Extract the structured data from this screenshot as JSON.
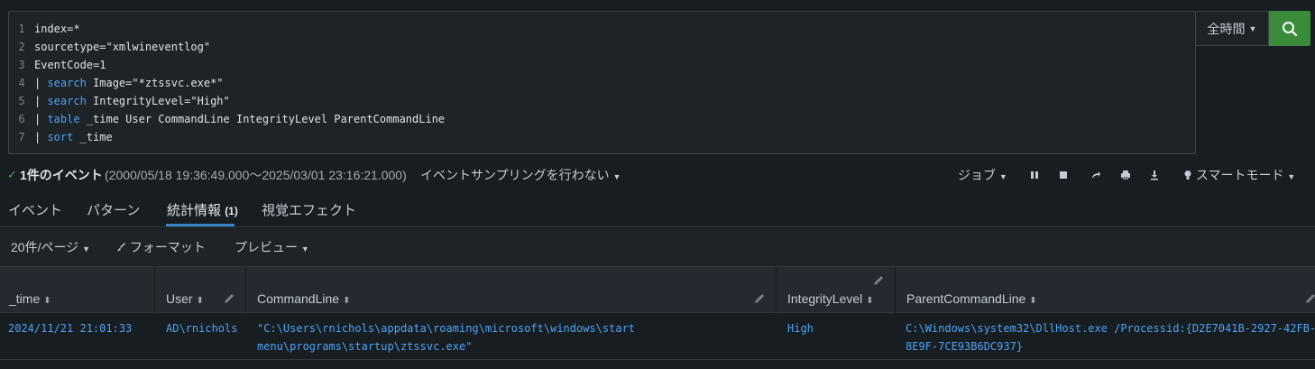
{
  "editor": {
    "lines": [
      {
        "no": "1",
        "pre": "",
        "kw": "",
        "rest": "index=*"
      },
      {
        "no": "2",
        "pre": "",
        "kw": "",
        "rest": "sourcetype=\"xmlwineventlog\""
      },
      {
        "no": "3",
        "pre": "",
        "kw": "",
        "rest": "EventCode=1"
      },
      {
        "no": "4",
        "pre": "| ",
        "kw": "search",
        "rest": " Image=\"*ztssvc.exe*\""
      },
      {
        "no": "5",
        "pre": "| ",
        "kw": "search",
        "rest": " IntegrityLevel=\"High\""
      },
      {
        "no": "6",
        "pre": "| ",
        "kw": "table",
        "rest": " _time User CommandLine IntegrityLevel ParentCommandLine"
      },
      {
        "no": "7",
        "pre": "| ",
        "kw": "sort",
        "rest": " _time"
      }
    ]
  },
  "time_picker": {
    "label": "全時間"
  },
  "status": {
    "count": "1件のイベント",
    "range": "(2000/05/18 19:36:49.000～2025/03/01 23:16:21.000)",
    "sampling": "イベントサンプリングを行わない",
    "job": "ジョブ",
    "smart_mode": "スマートモード"
  },
  "tabs": [
    {
      "label": "イベント"
    },
    {
      "label": "パターン"
    },
    {
      "label": "統計情報",
      "count": "(1)"
    },
    {
      "label": "視覚エフェクト"
    }
  ],
  "results_toolbar": {
    "per_page": "20件/ページ",
    "format": "フォーマット",
    "preview": "プレビュー"
  },
  "table": {
    "columns": [
      "_time",
      "User",
      "CommandLine",
      "IntegrityLevel",
      "ParentCommandLine"
    ],
    "rows": [
      {
        "time": "2024/11/21 21:01:33",
        "user": "AD\\rnichols",
        "commandline_1": "\"C:\\Users\\rnichols\\appdata\\roaming\\microsoft\\windows\\start",
        "commandline_2": "menu\\programs\\startup\\ztssvc.exe\"",
        "integrity": "High",
        "parent_1": "C:\\Windows\\system32\\DllHost.exe /Processid:{D2E7041B-2927-42FB-",
        "parent_2": "8E9F-7CE93B6DC937}"
      }
    ]
  },
  "colors": {
    "search_button": "#3a8c3b",
    "accent": "#3c86c6",
    "link": "#4fa3f5",
    "success": "#53a051"
  }
}
